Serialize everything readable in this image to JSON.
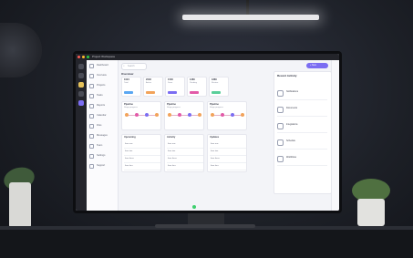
{
  "scene": {
    "monitor_app_title": "Project Workspace",
    "search_placeholder": "Search",
    "new_button_label": "+ New",
    "board_title": "Overview",
    "panel_title": "Recent Activity"
  },
  "sidebar": {
    "items": [
      {
        "label": "Dashboard",
        "icon": "home-icon"
      },
      {
        "label": "Overview",
        "icon": "grid-icon"
      },
      {
        "label": "Projects",
        "icon": "folder-icon"
      },
      {
        "label": "Tasks",
        "icon": "check-icon"
      },
      {
        "label": "Reports",
        "icon": "chart-icon"
      },
      {
        "label": "Calendar",
        "icon": "calendar-icon"
      },
      {
        "label": "Files",
        "icon": "file-icon"
      },
      {
        "label": "Messages",
        "icon": "chat-icon"
      },
      {
        "label": "Team",
        "icon": "users-icon"
      },
      {
        "label": "Settings",
        "icon": "gear-icon"
      },
      {
        "label": "Support",
        "icon": "help-icon"
      }
    ]
  },
  "top_cards": [
    {
      "title": "1024",
      "sub": "Total",
      "tag_color": "#5aa7f2"
    },
    {
      "title": "2048",
      "sub": "Active",
      "tag_color": "#f2a35a"
    },
    {
      "title": "1536",
      "sub": "Done",
      "tag_color": "#7b6df2"
    },
    {
      "title": "1280",
      "sub": "Pending",
      "tag_color": "#e25aa8"
    },
    {
      "title": "1880",
      "sub": "Review",
      "tag_color": "#5acf9a"
    }
  ],
  "flow_cards": [
    {
      "title": "Pipeline",
      "sub": "Stage progress"
    },
    {
      "title": "Pipeline",
      "sub": "Stage progress"
    },
    {
      "title": "Pipeline",
      "sub": "Stage progress"
    }
  ],
  "lists": [
    {
      "title": "Upcoming",
      "rows": [
        "Item one",
        "Item two",
        "Item three",
        "Item four"
      ]
    },
    {
      "title": "Activity",
      "rows": [
        "Item one",
        "Item two",
        "Item three",
        "Item four"
      ]
    },
    {
      "title": "Updates",
      "rows": [
        "Item one",
        "Item two",
        "Item three",
        "Item four"
      ]
    }
  ],
  "right_panel": {
    "items": [
      {
        "label": "Notifications",
        "icon": "bell-icon"
      },
      {
        "label": "Documents",
        "icon": "doc-icon"
      },
      {
        "label": "Integrations",
        "icon": "plug-icon"
      },
      {
        "label": "Schedule",
        "icon": "calendar-icon"
      },
      {
        "label": "Workflows",
        "icon": "flow-icon"
      }
    ]
  },
  "colors": {
    "accent": "#7b6df2",
    "status_green": "#3ecf6e"
  }
}
